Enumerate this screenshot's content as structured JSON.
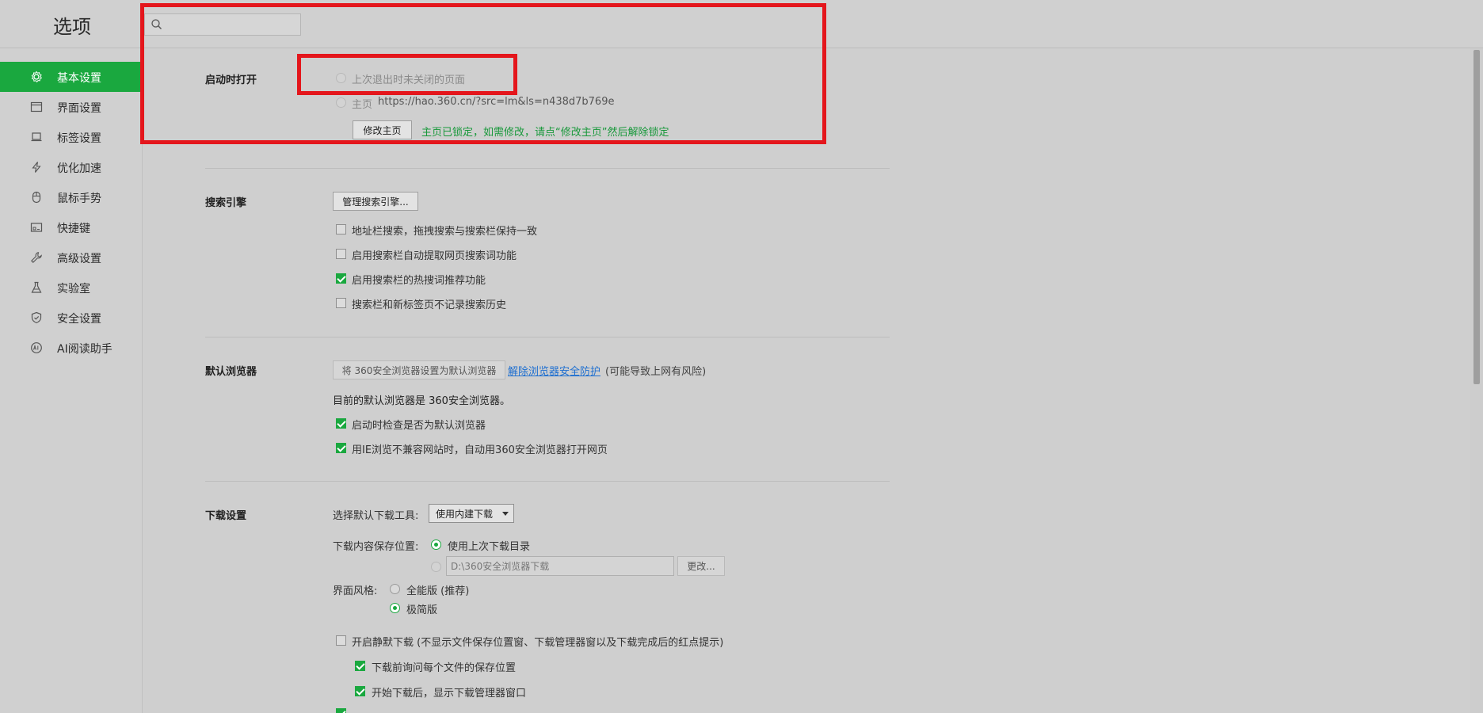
{
  "app": {
    "title": "选项"
  },
  "search": {
    "placeholder": "",
    "value": ""
  },
  "sidebar": {
    "items": [
      {
        "label": "基本设置",
        "icon": "gear-icon",
        "active": true
      },
      {
        "label": "界面设置",
        "icon": "window-icon",
        "active": false
      },
      {
        "label": "标签设置",
        "icon": "tab-icon",
        "active": false
      },
      {
        "label": "优化加速",
        "icon": "lightning-icon",
        "active": false
      },
      {
        "label": "鼠标手势",
        "icon": "mouse-icon",
        "active": false
      },
      {
        "label": "快捷键",
        "icon": "keyboard-icon",
        "active": false
      },
      {
        "label": "高级设置",
        "icon": "wrench-icon",
        "active": false
      },
      {
        "label": "实验室",
        "icon": "flask-icon",
        "active": false
      },
      {
        "label": "安全设置",
        "icon": "shield-icon",
        "active": false
      },
      {
        "label": "AI阅读助手",
        "icon": "ai-icon",
        "active": false
      }
    ]
  },
  "startup": {
    "label": "启动时打开",
    "option_last_session": "上次退出时未关闭的页面",
    "option_homepage": "主页",
    "homepage_url": "https://hao.360.cn/?src=lm&ls=n438d7b769e",
    "modify_button": "修改主页",
    "lock_notice": "主页已锁定，如需修改，请点“修改主页”然后解除锁定"
  },
  "search_engine": {
    "label": "搜索引擎",
    "manage_button": "管理搜索引擎...",
    "options": [
      {
        "label": "地址栏搜索，拖拽搜索与搜索栏保持一致",
        "checked": false
      },
      {
        "label": "启用搜索栏自动提取网页搜索词功能",
        "checked": false
      },
      {
        "label": "启用搜索栏的热搜词推荐功能",
        "checked": true
      },
      {
        "label": "搜索栏和新标签页不记录搜索历史",
        "checked": false
      }
    ]
  },
  "default_browser": {
    "label": "默认浏览器",
    "set_default_button": "将 360安全浏览器设置为默认浏览器",
    "unlock_link": "解除浏览器安全防护",
    "risk_note": "(可能导致上网有风险)",
    "current_status": "目前的默认浏览器是 360安全浏览器。",
    "options": [
      {
        "label": "启动时检查是否为默认浏览器",
        "checked": true
      },
      {
        "label": "用IE浏览不兼容网站时，自动用360安全浏览器打开网页",
        "checked": true
      }
    ]
  },
  "download": {
    "label": "下载设置",
    "tool_label": "选择默认下载工具:",
    "tool_value": "使用内建下载",
    "location_label": "下载内容保存位置:",
    "use_last_dir": "使用上次下载目录",
    "custom_path": "D:\\360安全浏览器下载",
    "change_button": "更改...",
    "style_label": "界面风格:",
    "style_full": "全能版 (推荐)",
    "style_simple": "极简版",
    "silent_download": {
      "label": "开启静默下载 (不显示文件保存位置窗、下载管理器窗以及下载完成后的红点提示)",
      "checked": false
    },
    "ask_location": {
      "label": "下载前询问每个文件的保存位置",
      "checked": true
    },
    "show_manager": {
      "label": "开始下载后，显示下载管理器窗口",
      "checked": true
    }
  },
  "colors": {
    "accent": "#1aa83f",
    "annotation": "#e4161c",
    "link": "#1e6fd0"
  }
}
